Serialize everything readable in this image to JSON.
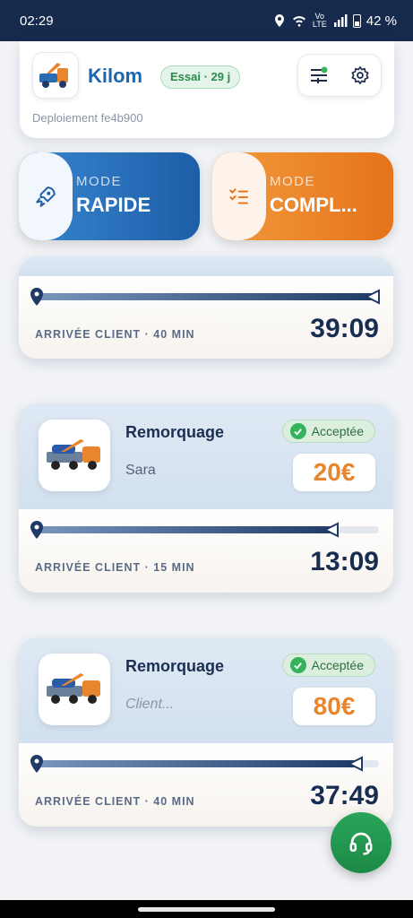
{
  "status_bar": {
    "time": "02:29",
    "network": "Vo LTE",
    "battery": "42 %"
  },
  "header": {
    "brand": "Kilom",
    "trial_badge": "Essai · 29 j",
    "deploy_text": "Deploiement fe4b900",
    "icons": [
      "tow-truck-logo-icon",
      "filter-sliders-icon",
      "gear-icon"
    ]
  },
  "modes": [
    {
      "sub": "MODE",
      "label": "RAPIDE",
      "icon": "rocket-icon",
      "color": "#1c5ea8"
    },
    {
      "sub": "MODE",
      "label": "COMPL...",
      "icon": "checklist-icon",
      "color": "#e5731b"
    }
  ],
  "active_trip": {
    "arrival_label": "ARRIVÉE CLIENT · 40 MIN",
    "countdown": "39:09",
    "progress": 1.0
  },
  "trips": [
    {
      "service": "Remorquage",
      "client": "Sara",
      "client_is_placeholder": false,
      "status": "Acceptée",
      "price": "20€",
      "arrival_label": "ARRIVÉE CLIENT · 15 MIN",
      "countdown": "13:09",
      "progress": 0.88
    },
    {
      "service": "Remorquage",
      "client": "Client...",
      "client_is_placeholder": true,
      "status": "Acceptée",
      "price": "80€",
      "arrival_label": "ARRIVÉE CLIENT · 40 MIN",
      "countdown": "37:49",
      "progress": 0.95
    }
  ],
  "fab": {
    "icon": "headset-icon"
  },
  "colors": {
    "accent_blue": "#1c67b0",
    "accent_orange": "#e8862e",
    "success_green": "#35b25c",
    "dark_navy": "#172e52"
  }
}
